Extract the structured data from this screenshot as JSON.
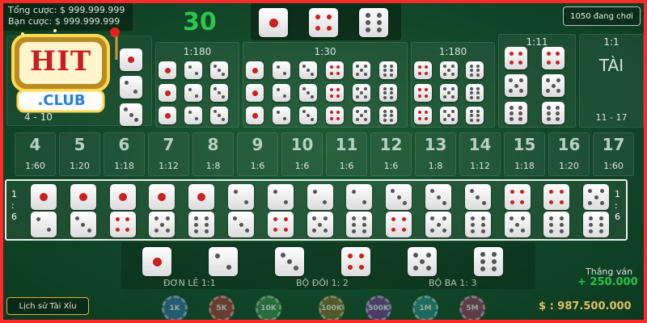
{
  "header": {
    "total_bet_label": "Tổng cược: $",
    "total_bet_value": "999.999.999",
    "your_bet_label": "Bạn cược: $",
    "your_bet_value": "999.999.999",
    "countdown": "30",
    "result_dice": [
      1,
      4,
      6
    ],
    "players_button": "1050 đang chơi"
  },
  "logo": {
    "title": "HIT",
    "subtitle": ".CLUB"
  },
  "small_bet": {
    "range": "4 - 10"
  },
  "big_bet": {
    "ratio": "1:11",
    "ratio_label": "1:1",
    "label": "TÀI",
    "range": "11 - 17"
  },
  "triple_any": {
    "ratio": "1:180"
  },
  "double_center": {
    "ratio": "1:30"
  },
  "triple_right": {
    "ratio": "1:180"
  },
  "totals": [
    {
      "sum": "4",
      "ratio": "1:60"
    },
    {
      "sum": "5",
      "ratio": "1:20"
    },
    {
      "sum": "6",
      "ratio": "1:18"
    },
    {
      "sum": "7",
      "ratio": "1:12"
    },
    {
      "sum": "8",
      "ratio": "1:8"
    },
    {
      "sum": "9",
      "ratio": "1:6"
    },
    {
      "sum": "10",
      "ratio": "1:6"
    },
    {
      "sum": "11",
      "ratio": "1:6"
    },
    {
      "sum": "12",
      "ratio": "1:6"
    },
    {
      "sum": "13",
      "ratio": "1:8"
    },
    {
      "sum": "14",
      "ratio": "1:12"
    },
    {
      "sum": "15",
      "ratio": "1:18"
    },
    {
      "sum": "16",
      "ratio": "1:20"
    },
    {
      "sum": "17",
      "ratio": "1:60"
    }
  ],
  "combo_row": {
    "side_label_left": "1 : 6",
    "side_label_right": "1 : 6",
    "pairs": [
      [
        1,
        2
      ],
      [
        1,
        3
      ],
      [
        1,
        4
      ],
      [
        1,
        5
      ],
      [
        1,
        6
      ],
      [
        2,
        3
      ],
      [
        2,
        4
      ],
      [
        2,
        5
      ],
      [
        2,
        6
      ],
      [
        3,
        4
      ],
      [
        3,
        5
      ],
      [
        3,
        6
      ],
      [
        4,
        5
      ],
      [
        4,
        6
      ],
      [
        5,
        6
      ]
    ]
  },
  "singles": {
    "dice": [
      1,
      2,
      3,
      4,
      5,
      6
    ],
    "single_label": "ĐƠN LẺ 1:1",
    "double_label": "BỘ ĐÔI 1: 2",
    "triple_label": "BỘ BA 1: 3"
  },
  "history_button": "Lịch sử Tài Xỉu",
  "chips": [
    "1K",
    "5K",
    "10K",
    "100K",
    "500K",
    "1M",
    "5M"
  ],
  "win": {
    "label": "Thắng ván",
    "value": "+ 250.000"
  },
  "balance": "$ : 987.500.000",
  "colors": {
    "pip_red": "#cc1f1f",
    "pip_dark": "#555555",
    "accent_green": "#27c24a",
    "gold": "#e0c060"
  }
}
